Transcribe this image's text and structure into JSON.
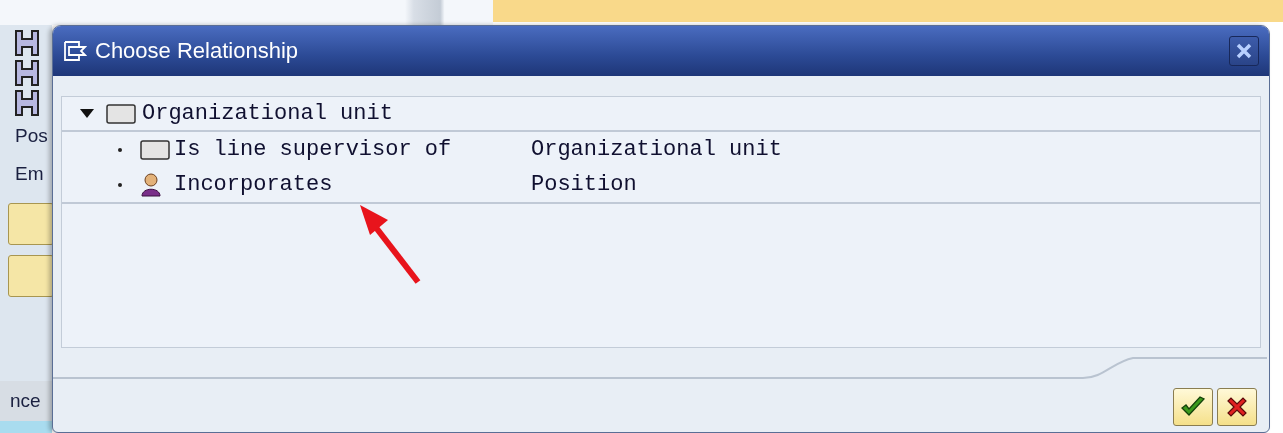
{
  "window": {
    "title": "Choose Relationship"
  },
  "background": {
    "labels": [
      "Pos",
      "Em",
      "nce"
    ]
  },
  "tree": {
    "label": "Organizational unit",
    "kind": "box",
    "expanded": true,
    "children": [
      {
        "relationship": "Is line supervisor of",
        "kind": "box",
        "target": "Organizational unit"
      },
      {
        "relationship": "Incorporates",
        "kind": "person",
        "target": "Position"
      }
    ]
  },
  "buttons": [
    {
      "kind": "confirm"
    },
    {
      "kind": "cancel"
    }
  ]
}
